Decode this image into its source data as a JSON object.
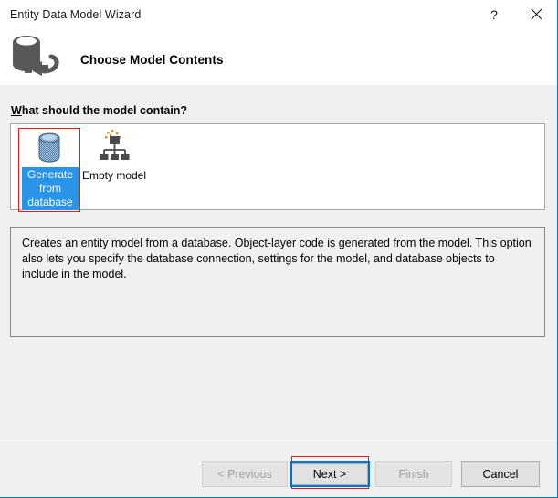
{
  "window": {
    "title": "Entity Data Model Wizard",
    "accent_color": "#0078d7",
    "annotation_color": "#e01b1b"
  },
  "titlebar": {
    "help_label": "?",
    "close_label": "×"
  },
  "header": {
    "icon": "database-plug-icon",
    "title": "Choose Model Contents"
  },
  "main": {
    "question_accel": "W",
    "question_rest": "hat should the model contain?",
    "options": [
      {
        "id": "generate-from-database",
        "label": "Generate from database",
        "icon": "database-cylinder-icon",
        "selected": true,
        "highlight_color": "#2a95e8"
      },
      {
        "id": "empty-model",
        "label": "Empty model",
        "icon": "model-hierarchy-icon",
        "selected": false
      }
    ],
    "description": "Creates an entity model from a database. Object-layer code is generated from the model. This option also lets you specify the database connection, settings for the model, and database objects to include in the model."
  },
  "footer": {
    "buttons": [
      {
        "id": "previous",
        "label": "< Previous",
        "accel": "P",
        "enabled": false,
        "focused": false
      },
      {
        "id": "next",
        "label": "Next >",
        "accel": "N",
        "enabled": true,
        "focused": true
      },
      {
        "id": "finish",
        "label": "Finish",
        "accel": "F",
        "enabled": false,
        "focused": false
      },
      {
        "id": "cancel",
        "label": "Cancel",
        "accel": "",
        "enabled": true,
        "focused": false
      }
    ]
  }
}
